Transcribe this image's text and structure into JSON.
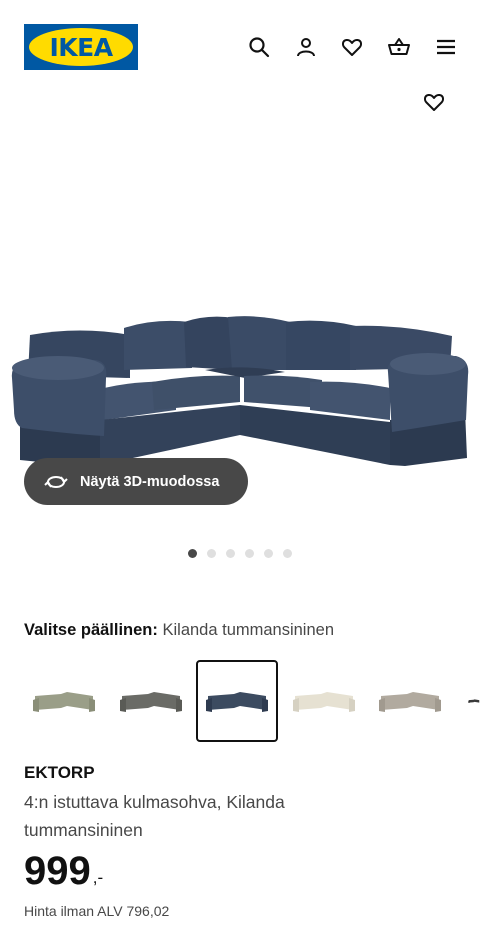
{
  "header": {
    "logo_text": "IKEA",
    "icons": [
      "search-icon",
      "account-icon",
      "heart-icon",
      "basket-icon",
      "menu-icon"
    ]
  },
  "gallery": {
    "favourite_icon": "heart-icon",
    "view_3d_label": "Näytä 3D-muodossa",
    "image_count": 6,
    "active_index": 0
  },
  "cover": {
    "label": "Valitse päällinen:",
    "value": "Kilanda tummansininen",
    "swatch_colors": [
      "#9a9e88",
      "#6a6b66",
      "#3c4b60",
      "#e6e1d2",
      "#b1aa9f",
      "#3a3a3a"
    ],
    "selected_index": 2
  },
  "product": {
    "name": "EKTORP",
    "description": "4:n istuttava kulmasohva, Kilanda tummansininen",
    "price": "999",
    "price_suffix": ",-",
    "vat_text": "Hinta ilman ALV 796,02"
  },
  "colors": {
    "brand_blue": "#0058a3",
    "brand_yellow": "#ffdb00",
    "sofa_color": "#3c4b60"
  }
}
